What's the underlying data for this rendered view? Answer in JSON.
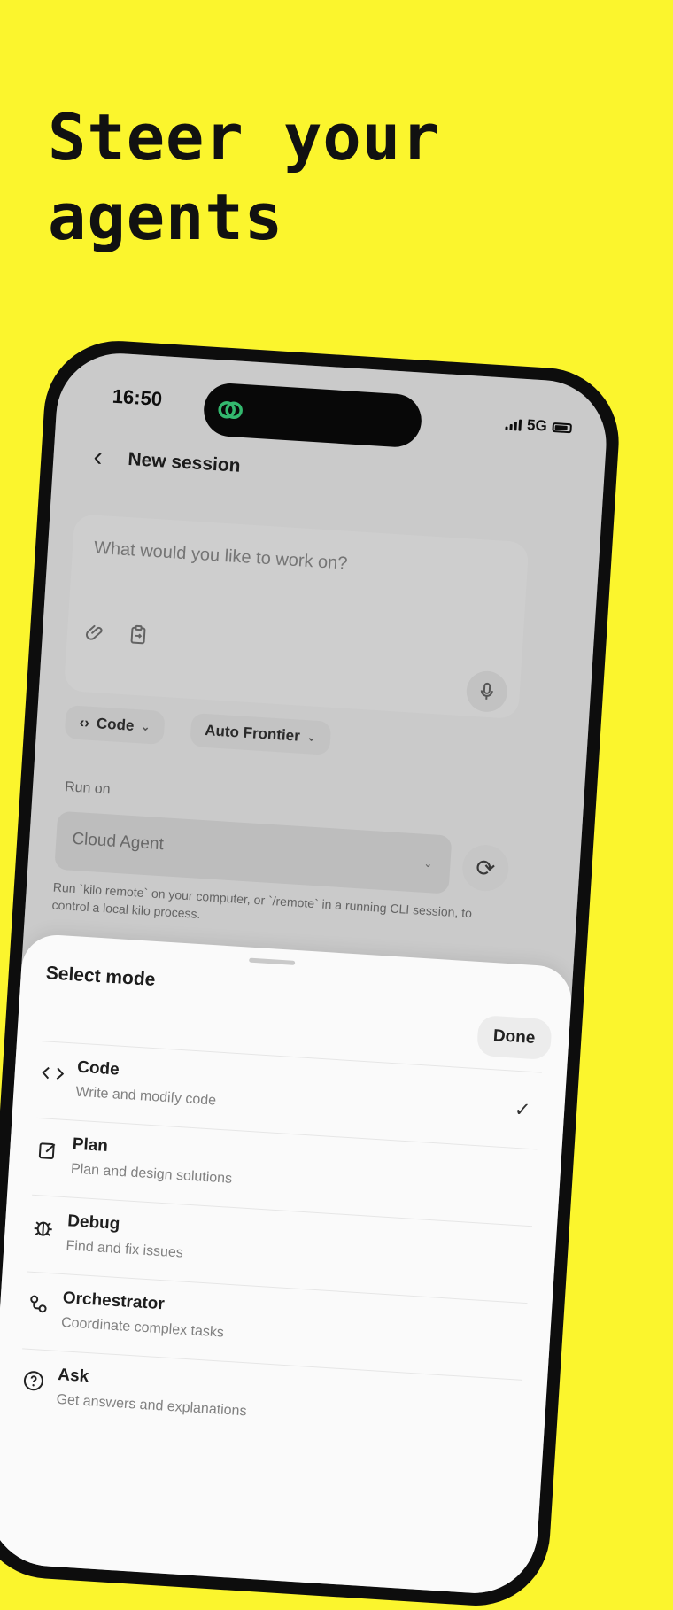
{
  "headline": {
    "line1": "Steer your",
    "line2": "agents"
  },
  "status_bar": {
    "time": "16:50",
    "network": "5G"
  },
  "nav": {
    "title": "New session"
  },
  "composer": {
    "placeholder": "What would you like to work on?"
  },
  "chips": {
    "mode": "Code",
    "model": "Auto Frontier"
  },
  "run_on": {
    "label": "Run on",
    "value": "Cloud Agent",
    "help": "Run `kilo remote` on your computer, or `/remote` in a running CLI session, to control a local kilo process."
  },
  "sheet": {
    "title": "Select mode",
    "done_label": "Done",
    "modes": [
      {
        "label": "Code",
        "description": "Write and modify code",
        "icon": "code-icon",
        "selected": true
      },
      {
        "label": "Plan",
        "description": "Plan and design solutions",
        "icon": "plan-icon",
        "selected": false
      },
      {
        "label": "Debug",
        "description": "Find and fix issues",
        "icon": "bug-icon",
        "selected": false
      },
      {
        "label": "Orchestrator",
        "description": "Coordinate complex tasks",
        "icon": "orchestrator-icon",
        "selected": false
      },
      {
        "label": "Ask",
        "description": "Get answers and explanations",
        "icon": "question-icon",
        "selected": false
      }
    ]
  },
  "colors": {
    "background": "#fbf52d",
    "phone_frame": "#0d0d0d",
    "island_logo": "#3ddc84"
  }
}
